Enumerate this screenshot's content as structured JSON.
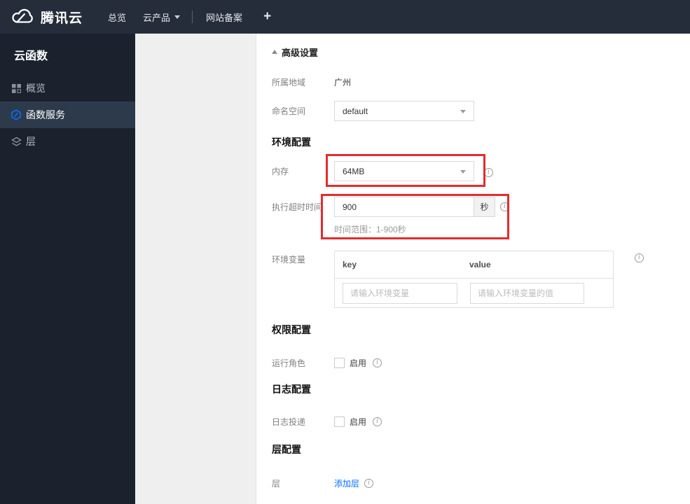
{
  "nav": {
    "brand": "腾讯云",
    "items": [
      {
        "label": "总览"
      },
      {
        "label": "云产品"
      },
      {
        "label": "网站备案"
      }
    ],
    "plus": "+"
  },
  "sidebar": {
    "title": "云函数",
    "items": [
      {
        "label": "概览",
        "icon": "grid-icon",
        "active": false
      },
      {
        "label": "函数服务",
        "icon": "function-hexagon-icon",
        "active": true
      },
      {
        "label": "层",
        "icon": "layers-icon",
        "active": false
      }
    ]
  },
  "content": {
    "advanced_toggle": "高级设置",
    "region": {
      "label": "所属地域",
      "value": "广州"
    },
    "namespace": {
      "label": "命名空间",
      "value": "default"
    },
    "sections": {
      "env": "环境配置",
      "permission": "权限配置",
      "log": "日志配置",
      "layer": "层配置"
    },
    "memory": {
      "label": "内存",
      "value": "64MB"
    },
    "timeout": {
      "label": "执行超时时间",
      "value": "900",
      "unit": "秒",
      "hint": "时间范围：1-900秒"
    },
    "envvar": {
      "label": "环境变量",
      "col_key": "key",
      "col_value": "value",
      "key_placeholder": "请输入环境变量",
      "value_placeholder": "请输入环境变量的值"
    },
    "role": {
      "label": "运行角色",
      "enable": "启用"
    },
    "logship": {
      "label": "日志投递",
      "enable": "启用"
    },
    "layer": {
      "label": "层",
      "add_link": "添加层"
    }
  },
  "colors": {
    "accent": "#006eff",
    "highlight_red": "#e22d2d",
    "navbar_bg": "#252d3b",
    "sidebar_bg": "#1b222e",
    "sidebar_active_bg": "#2c3a4b"
  }
}
